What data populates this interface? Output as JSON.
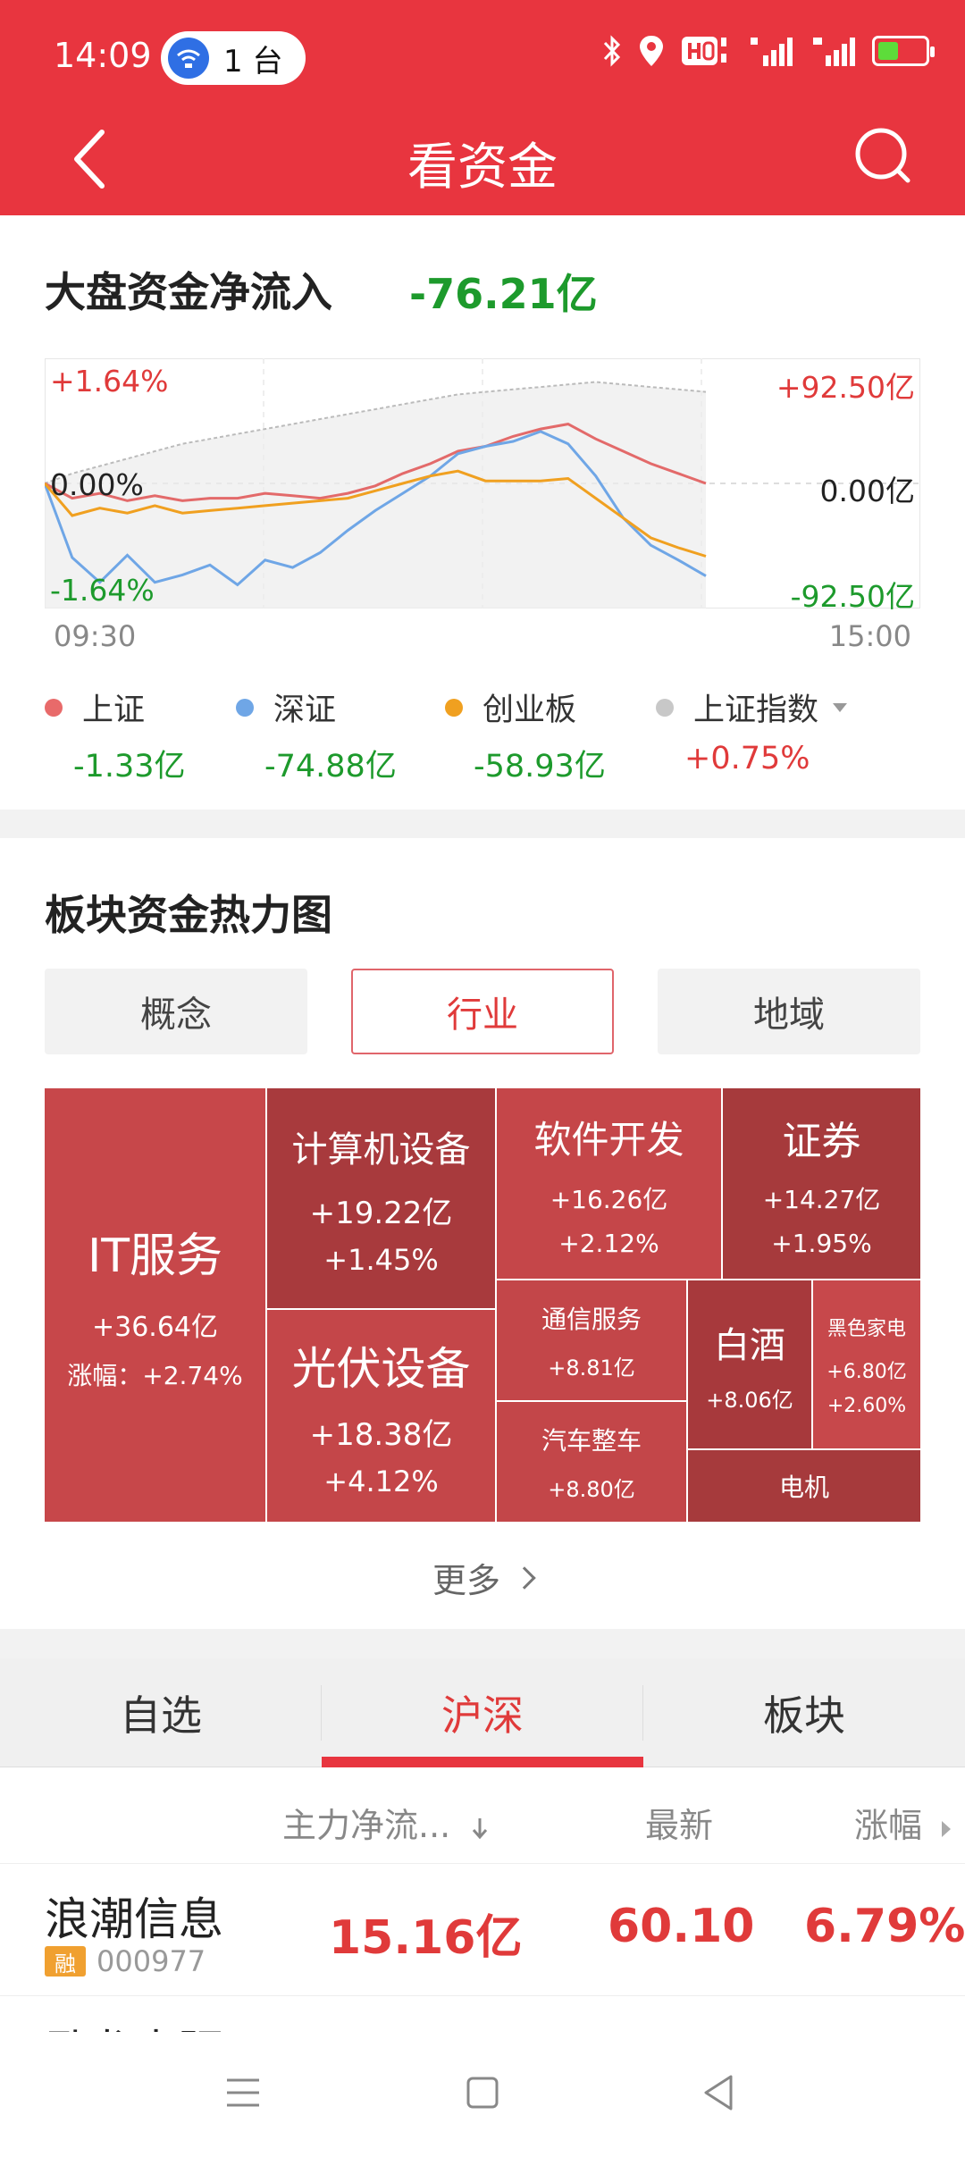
{
  "status_bar": {
    "time": "14:09",
    "pill_text": "1 台"
  },
  "nav": {
    "title": "看资金"
  },
  "market_flow": {
    "title": "大盘资金净流入",
    "net_value": "-76.21亿",
    "chart_data": {
      "type": "line",
      "title": "",
      "x_start_label": "09:30",
      "x_end_label": "15:00",
      "left_axis": {
        "top": "+1.64%",
        "mid": "0.00%",
        "bottom": "-1.64%"
      },
      "right_axis": {
        "top": "+92.50亿",
        "mid": "0.00亿",
        "bottom": "-92.50亿"
      },
      "ylim_yi": [
        -92.5,
        92.5
      ],
      "x": [
        0,
        10,
        20,
        30,
        40,
        50,
        60,
        70,
        80,
        90,
        100,
        110,
        120,
        130,
        140,
        150,
        160,
        170,
        180,
        190,
        200,
        210,
        220,
        230,
        240
      ],
      "series": [
        {
          "name": "上证",
          "color": "#e36a6a",
          "values": [
            0,
            -12,
            -8,
            -14,
            -10,
            -14,
            -12,
            -12,
            -8,
            -10,
            -12,
            -8,
            -2,
            8,
            16,
            26,
            30,
            38,
            44,
            48,
            36,
            26,
            16,
            8,
            0
          ]
        },
        {
          "name": "深证",
          "color": "#6fa6e6",
          "values": [
            0,
            -60,
            -80,
            -58,
            -80,
            -74,
            -66,
            -82,
            -62,
            -68,
            -56,
            -38,
            -22,
            -8,
            6,
            24,
            30,
            34,
            42,
            32,
            6,
            -28,
            -50,
            -62,
            -74.88
          ]
        },
        {
          "name": "创业板",
          "color": "#f0a020",
          "values": [
            0,
            -26,
            -20,
            -24,
            -18,
            -24,
            -22,
            -20,
            -18,
            -16,
            -14,
            -12,
            -6,
            0,
            6,
            10,
            2,
            2,
            2,
            4,
            -12,
            -28,
            -44,
            -52,
            -58.93
          ]
        },
        {
          "name": "上证指数",
          "color": "#bbbbbb",
          "values": [
            0,
            8,
            14,
            20,
            26,
            32,
            36,
            40,
            44,
            48,
            52,
            56,
            60,
            64,
            68,
            72,
            74,
            76,
            78,
            80,
            82,
            80,
            78,
            76,
            74
          ]
        }
      ]
    },
    "legend": [
      {
        "name": "上证",
        "value": "-1.33亿",
        "dot": "#e86a6a",
        "value_color": "green"
      },
      {
        "name": "深证",
        "value": "-74.88亿",
        "dot": "#6fa6e6",
        "value_color": "green"
      },
      {
        "name": "创业板",
        "value": "-58.93亿",
        "dot": "#f0a020",
        "value_color": "green"
      },
      {
        "name": "上证指数",
        "value": "+0.75%",
        "dot": "#c8c8c8",
        "value_color": "red"
      }
    ]
  },
  "heatmap": {
    "title": "板块资金热力图",
    "tabs": [
      "概念",
      "行业",
      "地域"
    ],
    "active_tab": 1,
    "tiles": [
      {
        "name": "IT服务",
        "amount": "+36.64亿",
        "pct": "涨幅：+2.74%"
      },
      {
        "name": "计算机设备",
        "amount": "+19.22亿",
        "pct": "+1.45%"
      },
      {
        "name": "光伏设备",
        "amount": "+18.38亿",
        "pct": "+4.12%"
      },
      {
        "name": "软件开发",
        "amount": "+16.26亿",
        "pct": "+2.12%"
      },
      {
        "name": "证券",
        "amount": "+14.27亿",
        "pct": "+1.95%"
      },
      {
        "name": "通信服务",
        "amount": "+8.81亿",
        "pct": ""
      },
      {
        "name": "汽车整车",
        "amount": "+8.80亿",
        "pct": ""
      },
      {
        "name": "白酒",
        "amount": "+8.06亿",
        "pct": ""
      },
      {
        "name": "黑色家电",
        "amount": "+6.80亿",
        "pct": "+2.60%"
      },
      {
        "name": "电机",
        "amount": "",
        "pct": ""
      }
    ],
    "more_label": "更多"
  },
  "bottom_tabs": {
    "tabs": [
      "自选",
      "沪深",
      "板块"
    ],
    "active": 1
  },
  "table": {
    "headers": {
      "net_flow": "主力净流...",
      "latest": "最新",
      "change": "涨幅"
    },
    "rows": [
      {
        "name": "浪潮信息",
        "tag": "融",
        "code": "000977",
        "net_flow": "15.16亿",
        "latest": "60.10",
        "change": "6.79%"
      },
      {
        "name": "卧龙电驱"
      }
    ]
  },
  "colors": {
    "brand_red": "#e8353f",
    "up_red": "#e03a3a",
    "down_green": "#1d9a2c"
  }
}
